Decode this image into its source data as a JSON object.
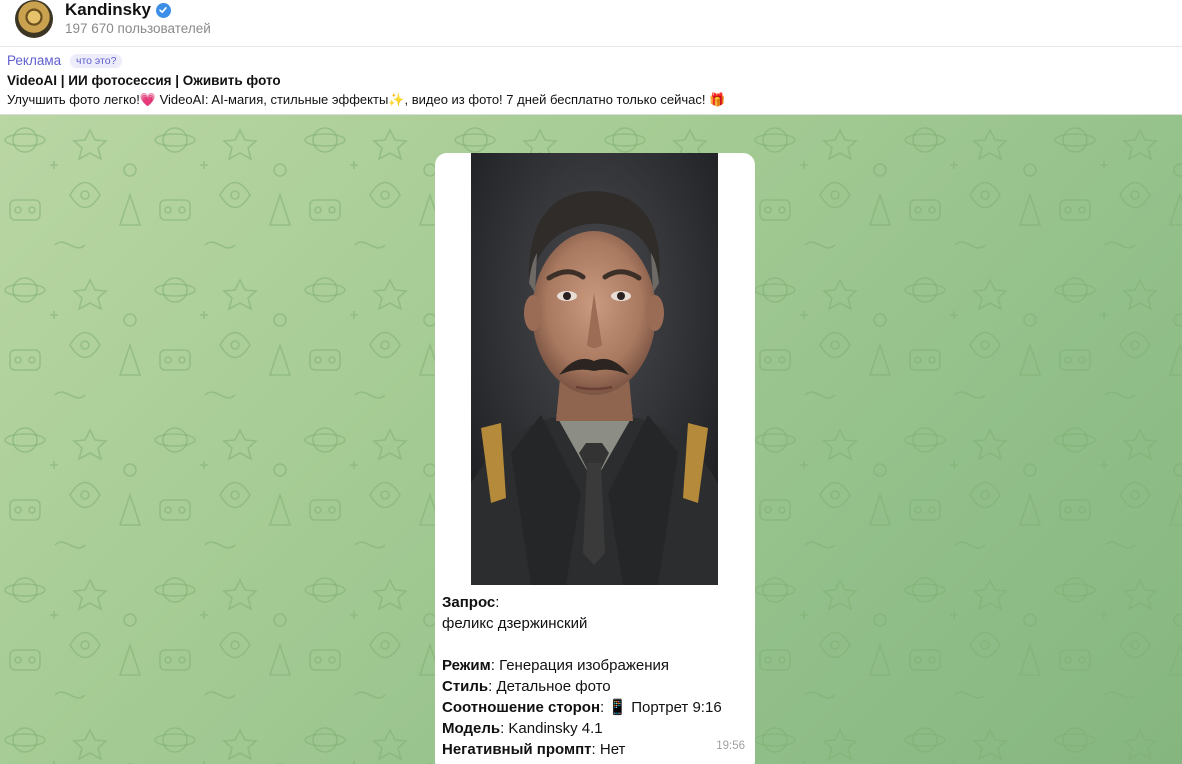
{
  "header": {
    "channel_name": "Kandinsky",
    "subscribers": "197 670 пользователей"
  },
  "ad": {
    "label": "Реклама",
    "what_is_it": "что это?",
    "title": "VideoAI | ИИ фотосессия | Оживить фото",
    "text_part1": "Улучшить фото легко!",
    "emoji1": "💗",
    "text_part2": " VideoAI: AI-магия, стильные эффекты",
    "emoji2": "✨",
    "text_part3": ", видео из фото! 7 дней бесплатно только сейчас! ",
    "emoji3": "🎁"
  },
  "message": {
    "image_alt": "portrait",
    "request_label": "Запрос",
    "request_value": "феликс дзержинский",
    "mode_label": "Режим",
    "mode_value": "Генерация изображения",
    "style_label": "Стиль",
    "style_value": "Детальное фото",
    "ratio_label": "Соотношение сторон",
    "ratio_icon": "📱",
    "ratio_value": "Портрет 9:16",
    "model_label": "Модель",
    "model_value": "Kandinsky 4.1",
    "negative_label": "Негативный промпт",
    "negative_value": "Нет",
    "time": "19:56"
  },
  "colors": {
    "accent": "#5f5fd0",
    "verified": "#3d8ee6",
    "chat_bg_start": "#b9d6a3",
    "chat_bg_end": "#86b680"
  }
}
